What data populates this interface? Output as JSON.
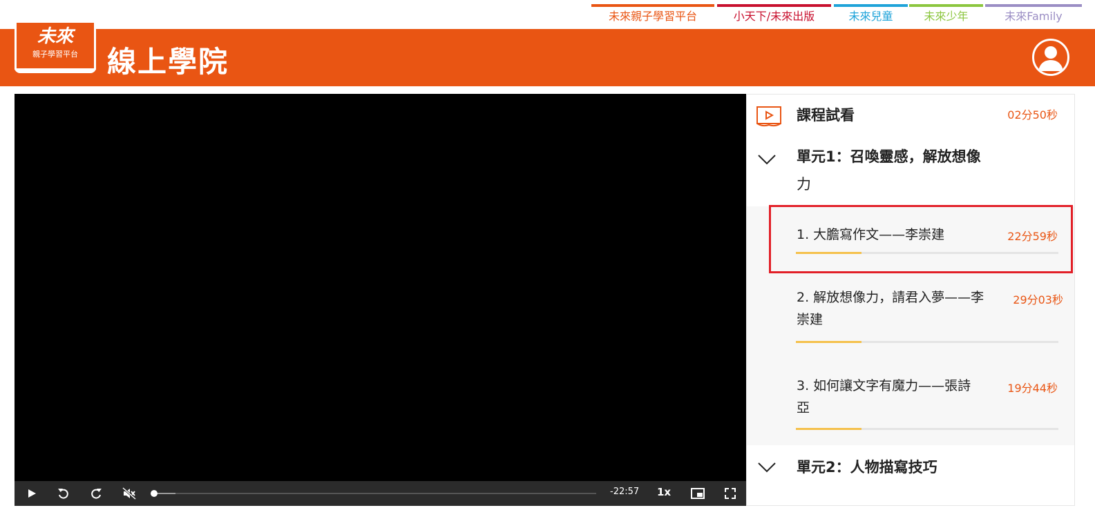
{
  "toplinks": [
    {
      "label": "未來親子學習平台",
      "color": "#e95513"
    },
    {
      "label": "小天下/未來出版",
      "color": "#c8102e"
    },
    {
      "label": "未來兒童",
      "color": "#1fa3d9"
    },
    {
      "label": "未來少年",
      "color": "#8cc63f"
    },
    {
      "label": "未來Family",
      "color": "#9b8ec4"
    }
  ],
  "header": {
    "logo_big": "未來",
    "logo_small": "親子學習平台",
    "title": "線上學院",
    "brand_color": "#e95513",
    "avatar_icon": "user-avatar-icon"
  },
  "player": {
    "time_remaining": "-22:57",
    "speed": "1x",
    "progress_fraction": 0.0,
    "buffered_fraction": 0.05,
    "controls": [
      "play-icon",
      "rewind-icon",
      "forward-icon",
      "mute-icon",
      "pip-icon",
      "fullscreen-icon"
    ]
  },
  "sidebar": {
    "preview": {
      "title": "課程試看",
      "duration": "02分50秒",
      "icon": "video-book-icon"
    },
    "unit1": {
      "title_line1": "單元1：召喚靈感，解放想像",
      "title_line2": "力",
      "icon": "chevron-down-icon",
      "lessons": [
        {
          "title_line1": "1. 大膽寫作文——李崇建",
          "title_line2": "",
          "duration": "22分59秒",
          "progress": 0.25
        },
        {
          "title_line1": "2. 解放想像力，請君入夢——李",
          "title_line2": "崇建",
          "duration": "29分03秒",
          "progress": 0.25
        },
        {
          "title_line1": "3. 如何讓文字有魔力——張詩",
          "title_line2": "亞",
          "duration": "19分44秒",
          "progress": 0.25
        }
      ]
    },
    "unit2": {
      "title": "單元2：人物描寫技巧",
      "icon": "chevron-down-icon"
    },
    "progress_color": "#f5c04a",
    "highlight_color": "#e21f27"
  }
}
